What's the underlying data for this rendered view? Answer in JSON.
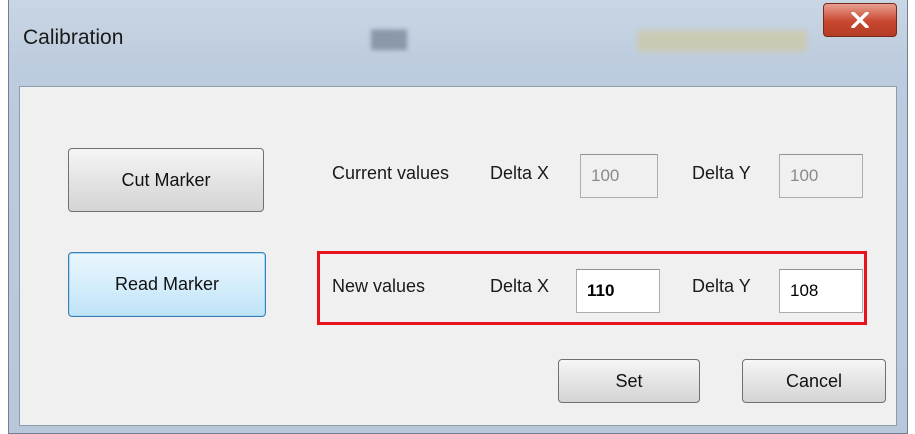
{
  "window": {
    "title": "Calibration"
  },
  "buttons": {
    "cut_marker": "Cut Marker",
    "read_marker": "Read Marker",
    "set": "Set",
    "cancel": "Cancel"
  },
  "current_values": {
    "label": "Current values",
    "delta_x_label": "Delta X",
    "delta_x_value": "100",
    "delta_y_label": "Delta Y",
    "delta_y_value": "100"
  },
  "new_values": {
    "label": "New values",
    "delta_x_label": "Delta X",
    "delta_x_value": "110",
    "delta_y_label": "Delta Y",
    "delta_y_value": "108"
  },
  "colors": {
    "highlight": "#e8121d",
    "close_button": "#c8472f"
  },
  "icons": {
    "close": "close-icon"
  }
}
